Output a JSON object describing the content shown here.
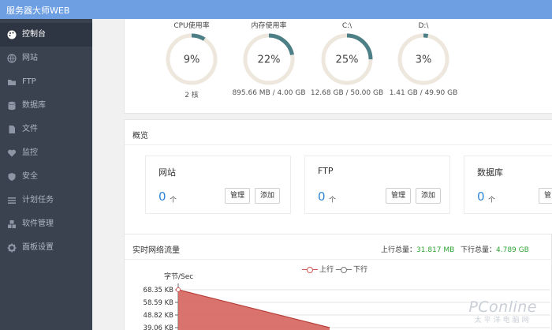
{
  "app": {
    "title": "服务器大师WEB"
  },
  "sidebar": {
    "items": [
      {
        "label": "控制台",
        "icon": "palette-icon",
        "active": true
      },
      {
        "label": "网站",
        "icon": "globe-icon",
        "active": false
      },
      {
        "label": "FTP",
        "icon": "folder-icon",
        "active": false
      },
      {
        "label": "数据库",
        "icon": "database-icon",
        "active": false
      },
      {
        "label": "文件",
        "icon": "file-icon",
        "active": false
      },
      {
        "label": "监控",
        "icon": "heartbeat-icon",
        "active": false
      },
      {
        "label": "安全",
        "icon": "shield-icon",
        "active": false
      },
      {
        "label": "计划任务",
        "icon": "list-icon",
        "active": false
      },
      {
        "label": "软件管理",
        "icon": "cubes-icon",
        "active": false
      },
      {
        "label": "面板设置",
        "icon": "gear-icon",
        "active": false
      }
    ]
  },
  "status": {
    "gauges": [
      {
        "title": "CPU使用率",
        "percent": 9,
        "value_label": "9%",
        "sub": "2 核"
      },
      {
        "title": "内存使用率",
        "percent": 22,
        "value_label": "22%",
        "sub": "895.66 MB / 4.00 GB"
      },
      {
        "title": "C:\\",
        "percent": 25,
        "value_label": "25%",
        "sub": "12.68 GB / 50.00 GB"
      },
      {
        "title": "D:\\",
        "percent": 3,
        "value_label": "3%",
        "sub": "1.41 GB / 49.90 GB"
      }
    ]
  },
  "overview": {
    "title": "概览",
    "cards": [
      {
        "title": "网站",
        "count": "0",
        "unit": "个",
        "manage": "管理",
        "add": "添加"
      },
      {
        "title": "FTP",
        "count": "0",
        "unit": "个",
        "manage": "管理",
        "add": "添加"
      },
      {
        "title": "数据库",
        "count": "0",
        "unit": "个",
        "manage": "管"
      }
    ]
  },
  "network": {
    "title": "实时网络流量",
    "upload_total_label": "上行总量：",
    "upload_total": "31.817 MB",
    "download_total_label": "下行总量：",
    "download_total": "4.789 GB",
    "legend_up": "上行",
    "legend_down": "下行",
    "unit_label": "字节/Sec"
  },
  "chart_data": {
    "type": "area",
    "ylabel": "字节/Sec",
    "ytick_labels": [
      "68.35 KB",
      "58.59 KB",
      "48.82 KB",
      "39.06 KB"
    ],
    "yticks": [
      68.35,
      58.59,
      48.82,
      39.06
    ],
    "series": [
      {
        "name": "上行",
        "color": "#d35a55",
        "points": [
          [
            0,
            68.35
          ],
          [
            1,
            39.06
          ]
        ]
      },
      {
        "name": "下行",
        "color": "#777777",
        "points": []
      }
    ]
  },
  "watermark": {
    "main": "PConline",
    "sub": "太平洋电脑网"
  },
  "colors": {
    "topbar": "#6e9fe3",
    "sidebar": "#3a4250",
    "gauge_track": "#ede7dd",
    "gauge_fill": "#4d7f86",
    "count_blue": "#2f86d6",
    "total_green": "#31a336",
    "upload_area": "#d35a55"
  }
}
